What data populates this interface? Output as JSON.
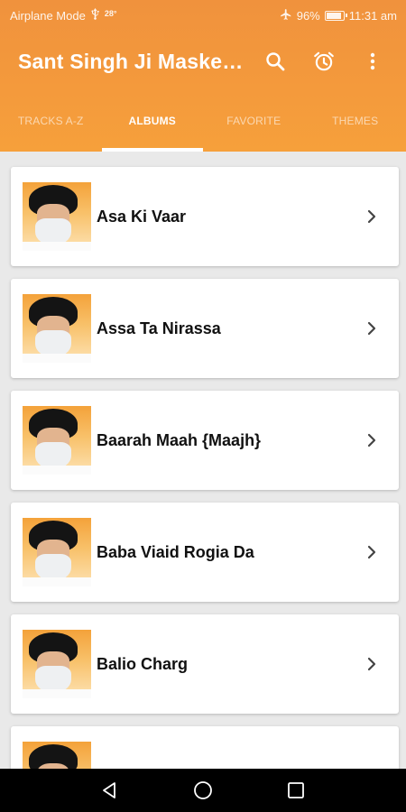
{
  "status_bar": {
    "left_text": "Airplane Mode",
    "temperature": "28°",
    "battery_percent": "96%",
    "time": "11:31 am",
    "icons": [
      "usb-icon",
      "airplane-icon",
      "battery-icon"
    ]
  },
  "toolbar": {
    "title": "Sant Singh Ji Maske…",
    "icons": [
      "search-icon",
      "alarm-icon",
      "more-vert-icon"
    ]
  },
  "tabs": [
    {
      "label": "TRACKS A-Z",
      "active": false
    },
    {
      "label": "ALBUMS",
      "active": true
    },
    {
      "label": "FAVORITE",
      "active": false
    },
    {
      "label": "THEMES",
      "active": false
    }
  ],
  "albums": [
    {
      "title": "Asa Ki Vaar"
    },
    {
      "title": "Assa Ta Nirassa"
    },
    {
      "title": "Baarah Maah {Maajh}"
    },
    {
      "title": "Baba Viaid Rogia Da"
    },
    {
      "title": "Balio Charg"
    },
    {
      "title": ""
    }
  ],
  "nav_bar": {
    "icons": [
      "back-icon",
      "home-icon",
      "recents-icon"
    ]
  },
  "colors": {
    "header_top": "#f0923d",
    "header_bottom": "#f6a03b",
    "background": "#e9e9e9",
    "card": "#ffffff",
    "navbar": "#000000"
  }
}
